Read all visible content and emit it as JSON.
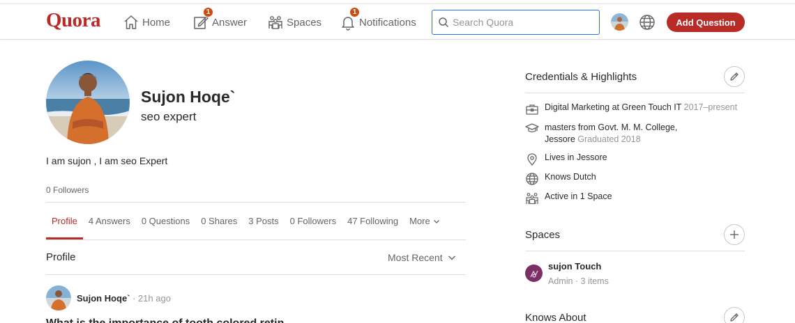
{
  "header": {
    "logo": "Quora",
    "nav": [
      {
        "label": "Home",
        "icon": "home-icon"
      },
      {
        "label": "Answer",
        "icon": "answer-icon",
        "badge": "1"
      },
      {
        "label": "Spaces",
        "icon": "spaces-icon"
      },
      {
        "label": "Notifications",
        "icon": "bell-icon",
        "badge": "1"
      }
    ],
    "search_placeholder": "Search Quora",
    "add_question": "Add Question"
  },
  "profile": {
    "name": "Sujon Hoqe`",
    "tagline": "seo expert",
    "bio": "I am sujon , I am seo Expert",
    "followers": "0 Followers",
    "tabs": [
      "Profile",
      "4 Answers",
      "0 Questions",
      "0 Shares",
      "3 Posts",
      "0 Followers",
      "47 Following",
      "More"
    ],
    "section_title": "Profile",
    "sort_label": "Most Recent",
    "post": {
      "author": "Sujon Hoqe`",
      "time": "· 21h ago",
      "question": "What is the importance of tooth colored retin..."
    }
  },
  "sidebar": {
    "credentials_title": "Credentials & Highlights",
    "credentials": [
      {
        "icon": "briefcase-icon",
        "text": "Digital Marketing at Green Touch IT",
        "muted": "2017–present"
      },
      {
        "icon": "graduation-cap-icon",
        "text": "masters from Govt. M. M. College,",
        "text2": "Jessore",
        "muted": "Graduated 2018"
      },
      {
        "icon": "location-pin-icon",
        "text": "Lives in Jessore"
      },
      {
        "icon": "globe-icon",
        "text": "Knows Dutch"
      },
      {
        "icon": "spaces-icon",
        "text": "Active in 1 Space"
      }
    ],
    "spaces_title": "Spaces",
    "space": {
      "name": "sujon Touch",
      "meta": "Admin · 3 items"
    },
    "knows_about_title": "Knows About"
  },
  "colors": {
    "brand": "#b92b27",
    "search_border": "#2e69ff",
    "badge": "#cb4b10",
    "space_icon_bg": "#7a2f66"
  }
}
